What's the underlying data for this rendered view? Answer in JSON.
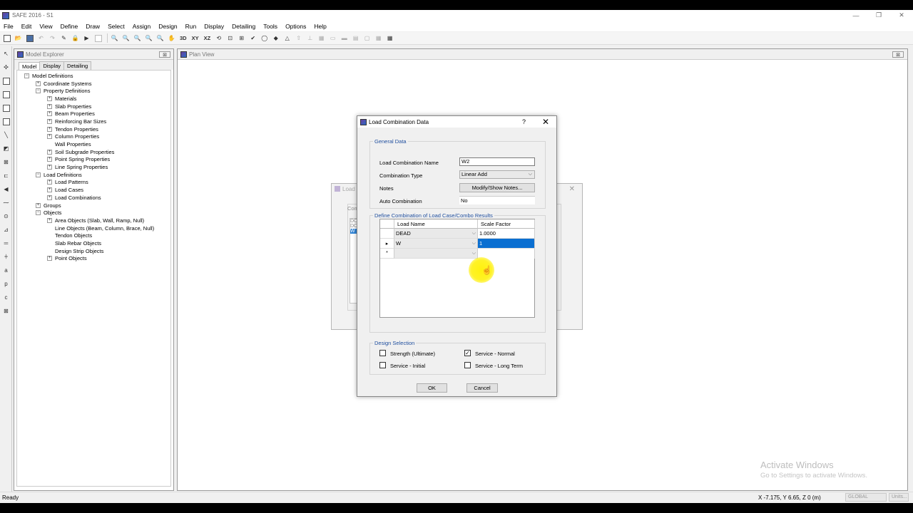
{
  "window": {
    "title": "SAFE 2016 - S1",
    "minimize": "—",
    "restore": "❐",
    "close": "✕"
  },
  "menu": [
    "File",
    "Edit",
    "View",
    "Define",
    "Draw",
    "Select",
    "Assign",
    "Design",
    "Run",
    "Display",
    "Detailing",
    "Tools",
    "Options",
    "Help"
  ],
  "toolbar": {
    "btn_3d": "3D",
    "btn_xy": "XY",
    "btn_xz": "XZ"
  },
  "explorer": {
    "title": "Model Explorer",
    "close": "⊠",
    "tabs": [
      "Model",
      "Display",
      "Detailing"
    ],
    "tree": [
      {
        "label": "Model Definitions",
        "level": 0,
        "exp": "−"
      },
      {
        "label": "Coordinate Systems",
        "level": 1,
        "exp": "+"
      },
      {
        "label": "Property Definitions",
        "level": 1,
        "exp": "−"
      },
      {
        "label": "Materials",
        "level": 2,
        "exp": "+"
      },
      {
        "label": "Slab Properties",
        "level": 2,
        "exp": "+"
      },
      {
        "label": "Beam Properties",
        "level": 2,
        "exp": "+"
      },
      {
        "label": "Reinforcing Bar Sizes",
        "level": 2,
        "exp": "+"
      },
      {
        "label": "Tendon Properties",
        "level": 2,
        "exp": "+"
      },
      {
        "label": "Column Properties",
        "level": 2,
        "exp": "+"
      },
      {
        "label": "Wall Properties",
        "level": 2,
        "exp": ""
      },
      {
        "label": "Soil Subgrade Properties",
        "level": 2,
        "exp": "+"
      },
      {
        "label": "Point Spring Properties",
        "level": 2,
        "exp": "+"
      },
      {
        "label": "Line Spring Properties",
        "level": 2,
        "exp": "+"
      },
      {
        "label": "Load Definitions",
        "level": 1,
        "exp": "−"
      },
      {
        "label": "Load Patterns",
        "level": 2,
        "exp": "+"
      },
      {
        "label": "Load Cases",
        "level": 2,
        "exp": "+"
      },
      {
        "label": "Load Combinations",
        "level": 2,
        "exp": "+"
      },
      {
        "label": "Groups",
        "level": 1,
        "exp": "+"
      },
      {
        "label": "Objects",
        "level": 1,
        "exp": "−"
      },
      {
        "label": "Area Objects (Slab, Wall, Ramp, Null)",
        "level": 2,
        "exp": "+"
      },
      {
        "label": "Line Objects (Beam, Column, Brace, Null)",
        "level": 2,
        "exp": ""
      },
      {
        "label": "Tendon Objects",
        "level": 2,
        "exp": ""
      },
      {
        "label": "Slab Rebar Objects",
        "level": 2,
        "exp": ""
      },
      {
        "label": "Design Strip Objects",
        "level": 2,
        "exp": ""
      },
      {
        "label": "Point Objects",
        "level": 2,
        "exp": "+"
      }
    ]
  },
  "planview": {
    "title": "Plan View",
    "close": "⊠"
  },
  "bg_dialog": {
    "title": "Load",
    "label": "Com",
    "list_items": [
      "DC",
      "DC",
      "W"
    ],
    "close": "✕"
  },
  "dialog": {
    "title": "Load Combination Data",
    "help": "?",
    "close": "✕",
    "general": {
      "heading": "General Data",
      "name_label": "Load Combination Name",
      "name_value": "W2",
      "type_label": "Combination Type",
      "type_value": "Linear Add",
      "notes_label": "Notes",
      "notes_button": "Modify/Show Notes...",
      "auto_label": "Auto Combination",
      "auto_value": "No"
    },
    "combo": {
      "heading": "Define Combination of Load Case/Combo Results",
      "col_name": "Load Name",
      "col_factor": "Scale Factor",
      "rows": [
        {
          "marker": "",
          "name": "DEAD",
          "factor": "1.0000"
        },
        {
          "marker": "▸",
          "name": "W",
          "factor": "1"
        },
        {
          "marker": "*",
          "name": "",
          "factor": ""
        }
      ]
    },
    "design": {
      "heading": "Design Selection",
      "strength": {
        "label": "Strength (Ultimate)",
        "checked": ""
      },
      "service_normal": {
        "label": "Service - Normal",
        "checked": "✓"
      },
      "service_initial": {
        "label": "Service - Initial",
        "checked": ""
      },
      "service_long": {
        "label": "Service - Long Term",
        "checked": ""
      }
    },
    "ok": "OK",
    "cancel": "Cancel"
  },
  "watermark": {
    "line1": "Activate Windows",
    "line2": "Go to Settings to activate Windows."
  },
  "status": {
    "text": "Ready",
    "coords": "X -7.175,  Y 6.65,  Z 0  (m)",
    "global": "GLOBAL",
    "units": "Units..."
  }
}
